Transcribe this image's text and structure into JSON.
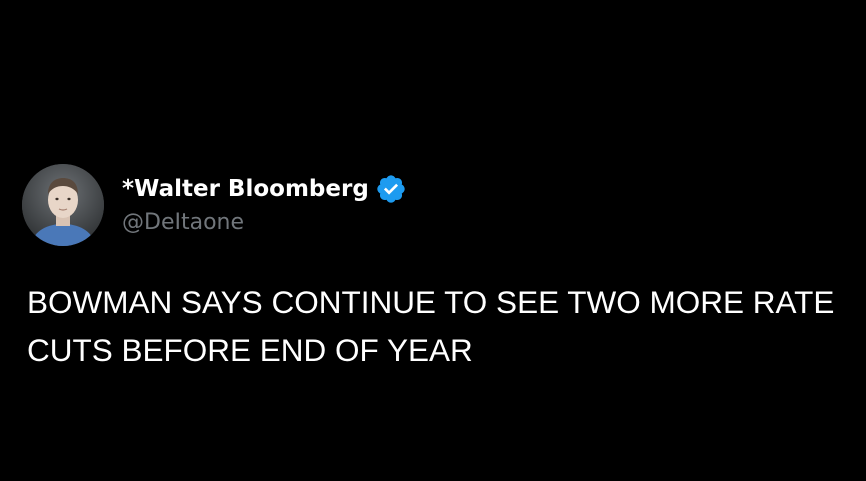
{
  "tweet": {
    "author": {
      "display_name": "*Walter Bloomberg",
      "handle": "@DeItaone",
      "verified": true,
      "verified_icon": "verified-badge-icon",
      "avatar_icon": "avatar"
    },
    "text_line_1": "BOWMAN SAYS CONTINUE TO SEE TWO MORE RATE",
    "text_line_2": "CUTS BEFORE END OF YEAR"
  },
  "colors": {
    "background": "#000000",
    "text": "#ffffff",
    "handle": "#71767b",
    "verified_badge": "#1d9bf0"
  }
}
